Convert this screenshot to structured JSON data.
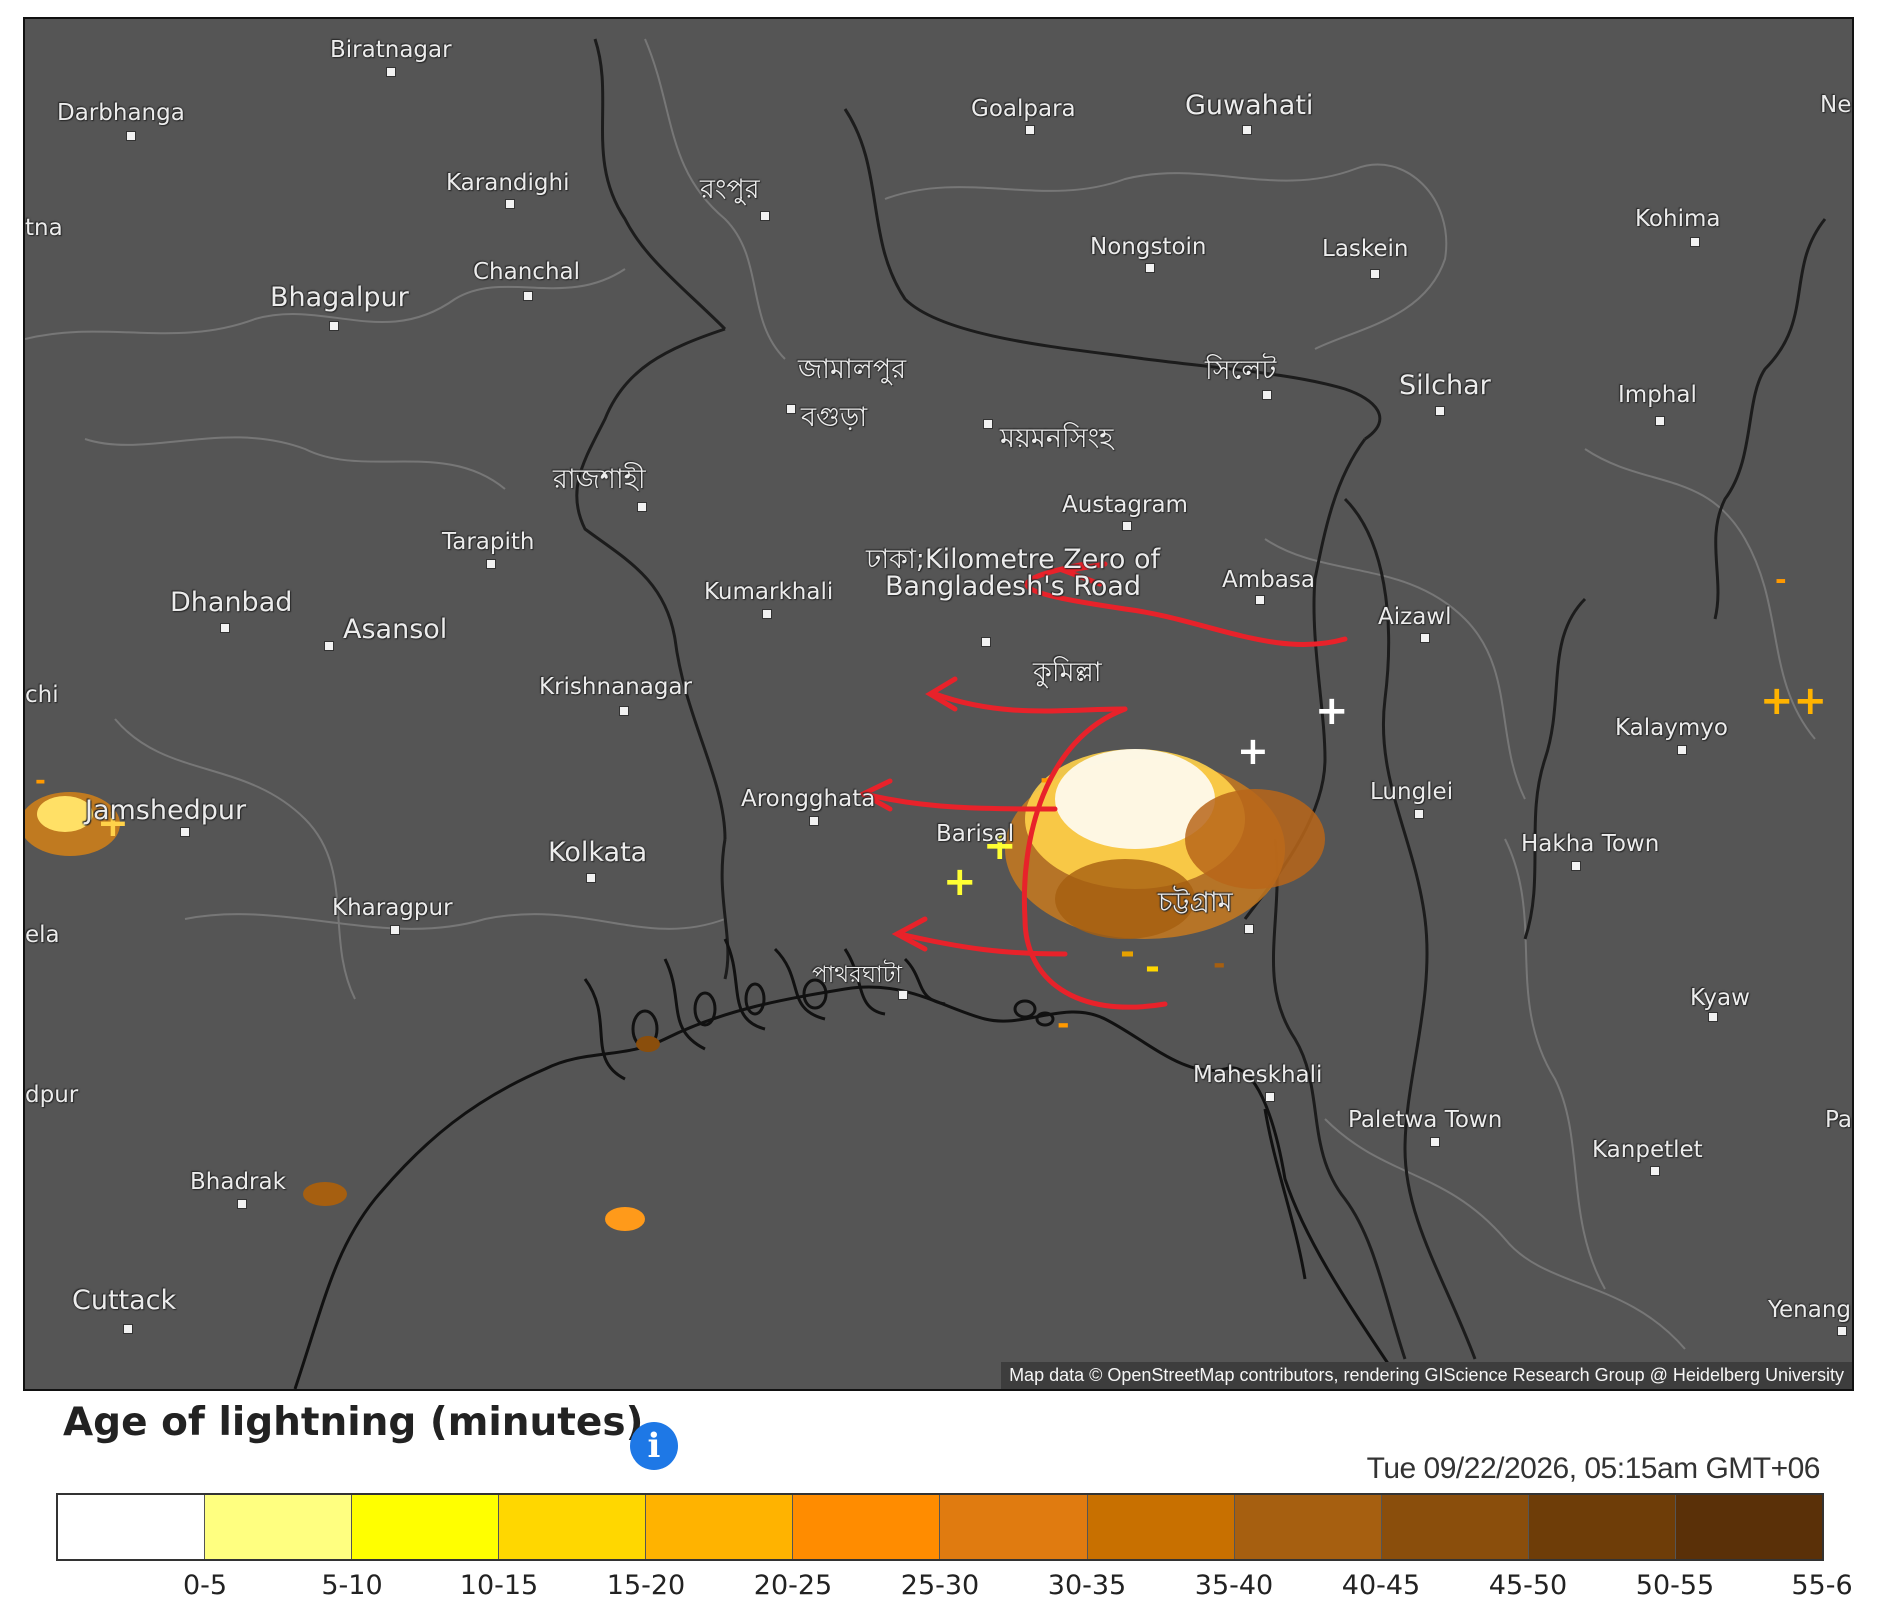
{
  "map": {
    "attribution": "Map data © OpenStreetMap contributors, rendering GIScience Research Group @ Heidelberg University",
    "place_labels": [
      "Biratnagar",
      "Darbhanga",
      "Goalpara",
      "Guwahati",
      "Karandighi",
      "রংপুর",
      "Kohima",
      "tna",
      "Chanchal",
      "Nongstoin",
      "Laskein",
      "Bhagalpur",
      "জামালপুর",
      "সিলেট",
      "Silchar",
      "Imphal",
      "বগুড়া",
      "ময়মনসিংহ",
      "রাজশাহী",
      "Austagram",
      "Tarapith",
      "ঢাকা;Kilometre Zero of Bangladesh's Road",
      "Ambasa",
      "Kumarkhali",
      "Aizawl",
      "Dhanbad",
      "Asansol",
      "কুমিল্লা",
      "chi",
      "Krishnanagar",
      "Kalaymyo",
      "Arongghata",
      "Lunglei",
      "Jamshedpur",
      "Kolkata",
      "Hakha Town",
      "Barisal",
      "চট্টগ্রাম",
      "Kharagpur",
      "ela",
      "পাথরঘাটা",
      "Kyaw",
      "Maheskhali",
      "dpur",
      "Paletwa Town",
      "Kanpetlet",
      "Bhadrak",
      "Cuttack",
      "Yenang",
      "Ne",
      "Pa"
    ]
  },
  "legend": {
    "title": "Age of lightning (minutes)",
    "timestamp": "Tue 09/22/2026, 05:15am GMT+06",
    "colors": [
      "#ffffff",
      "#ffff80",
      "#ffff00",
      "#ffd700",
      "#ffb300",
      "#ff8c00",
      "#e07b10",
      "#c87000",
      "#a65f10",
      "#8a4e0c",
      "#6e3d08",
      "#5a3008"
    ],
    "ticks": [
      "0-5",
      "5-10",
      "10-15",
      "15-20",
      "20-25",
      "25-30",
      "30-35",
      "35-40",
      "40-45",
      "45-50",
      "50-55",
      "55-6"
    ]
  }
}
